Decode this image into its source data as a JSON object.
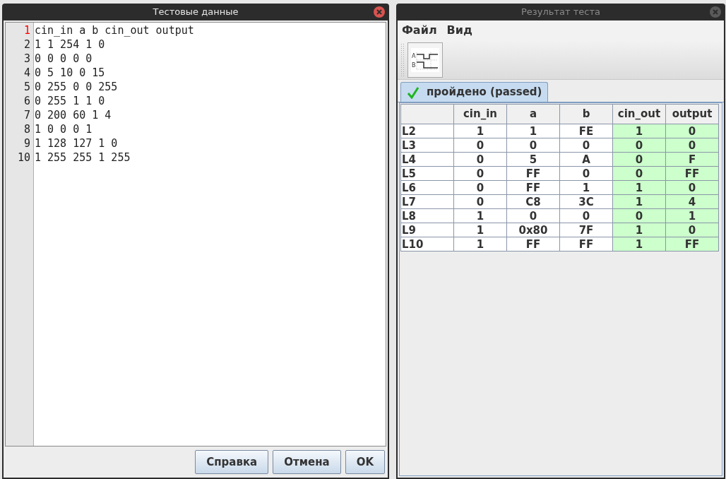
{
  "editor_window": {
    "title": "Тестовые данные",
    "active": true,
    "lines": [
      {
        "number": "1",
        "text": "cin_in a b cin_out output",
        "current": true
      },
      {
        "number": "2",
        "text": "1 1 254 1 0",
        "current": false
      },
      {
        "number": "3",
        "text": "0 0 0 0 0",
        "current": false
      },
      {
        "number": "4",
        "text": "0 5 10 0 15",
        "current": false
      },
      {
        "number": "5",
        "text": "0 255 0 0 255",
        "current": false
      },
      {
        "number": "6",
        "text": "0 255 1 1 0",
        "current": false
      },
      {
        "number": "7",
        "text": "0 200 60 1 4",
        "current": false
      },
      {
        "number": "8",
        "text": "1 0 0 0 1",
        "current": false
      },
      {
        "number": "9",
        "text": "1 128 127 1 0",
        "current": false
      },
      {
        "number": "10",
        "text": "1 255 255 1 255",
        "current": false
      }
    ],
    "buttons": [
      "Справка",
      "Отмена",
      "OK"
    ]
  },
  "result_window": {
    "title": "Результат теста",
    "active": false,
    "menu": [
      "Файл",
      "Вид"
    ],
    "toolbar_button_labels": [
      "A",
      "B"
    ],
    "tabs": [
      {
        "label": "пройдено (passed)",
        "selected": true
      }
    ],
    "table": {
      "columns": [
        {
          "kind": "label"
        },
        {
          "label": "cin_in",
          "kind": "input"
        },
        {
          "label": "a",
          "kind": "input"
        },
        {
          "label": "b",
          "kind": "input"
        },
        {
          "label": "cin_out",
          "kind": "output"
        },
        {
          "label": "output",
          "kind": "output"
        }
      ],
      "rows": [
        [
          "L2",
          "1",
          "1",
          "FE",
          "1",
          "0"
        ],
        [
          "L3",
          "0",
          "0",
          "0",
          "0",
          "0"
        ],
        [
          "L4",
          "0",
          "5",
          "A",
          "0",
          "F"
        ],
        [
          "L5",
          "0",
          "FF",
          "0",
          "0",
          "FF"
        ],
        [
          "L6",
          "0",
          "FF",
          "1",
          "1",
          "0"
        ],
        [
          "L7",
          "0",
          "C8",
          "3C",
          "1",
          "4"
        ],
        [
          "L8",
          "1",
          "0",
          "0",
          "0",
          "1"
        ],
        [
          "L9",
          "1",
          "0x80",
          "7F",
          "1",
          "0"
        ],
        [
          "L10",
          "1",
          "FF",
          "FF",
          "1",
          "FF"
        ]
      ]
    }
  }
}
